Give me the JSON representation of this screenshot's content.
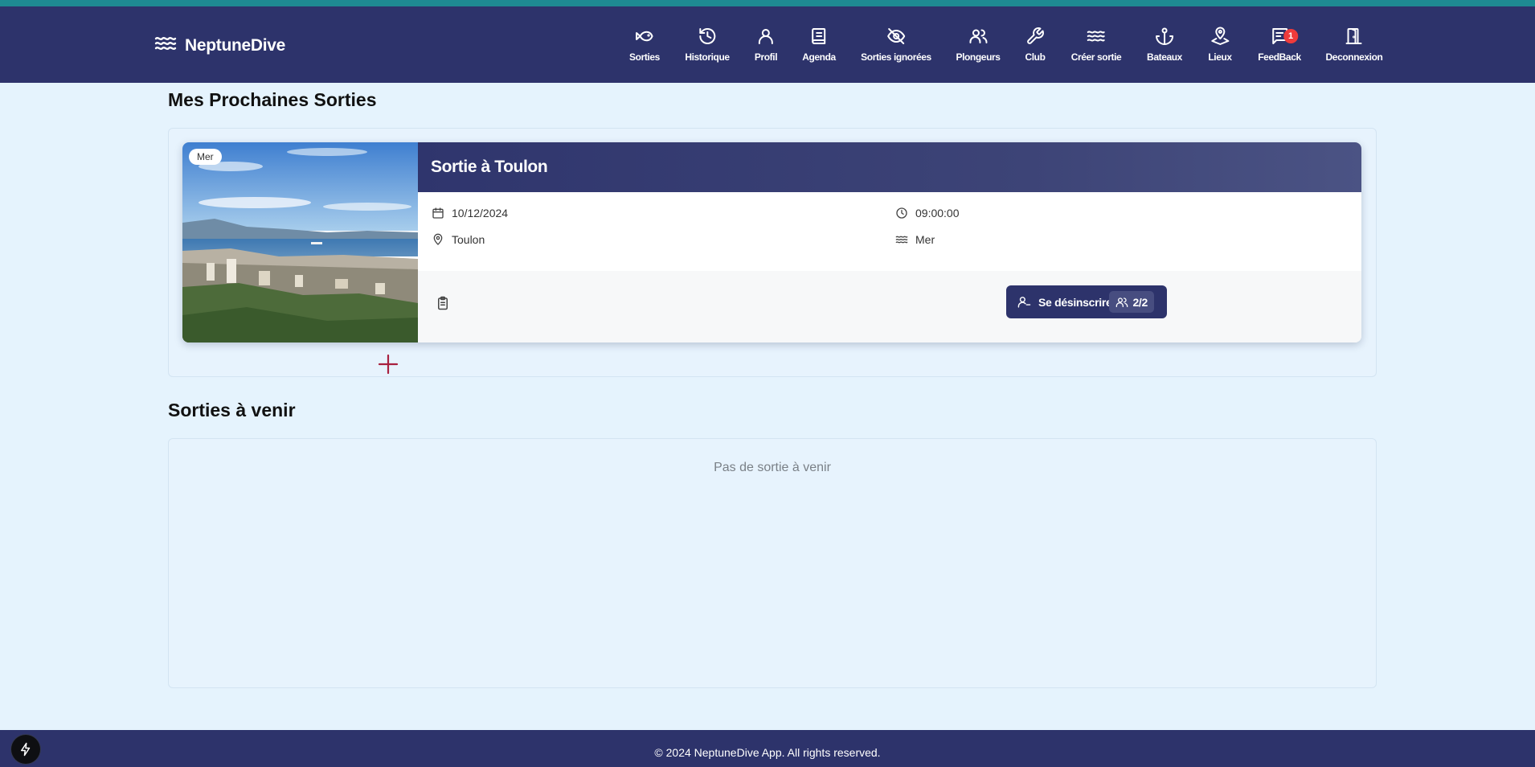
{
  "app": {
    "brand_name": "NeptuneDive",
    "brand_icon": "waves-icon",
    "primary_color": "#2d336b",
    "background_color": "#e5f3fd"
  },
  "nav": {
    "items": [
      {
        "label": "Sorties",
        "icon": "fish-icon"
      },
      {
        "label": "Historique",
        "icon": "history-icon"
      },
      {
        "label": "Profil",
        "icon": "user-icon"
      },
      {
        "label": "Agenda",
        "icon": "book-icon"
      },
      {
        "label": "Sorties ignorées",
        "icon": "eye-off-icon"
      },
      {
        "label": "Plongeurs",
        "icon": "users-icon"
      },
      {
        "label": "Club",
        "icon": "wrench-icon"
      },
      {
        "label": "Créer sortie",
        "icon": "waves-icon"
      },
      {
        "label": "Bateaux",
        "icon": "anchor-icon"
      },
      {
        "label": "Lieux",
        "icon": "map-pin-icon"
      },
      {
        "label": "FeedBack",
        "icon": "message-icon",
        "badge": "1"
      },
      {
        "label": "Deconnexion",
        "icon": "door-icon"
      }
    ]
  },
  "my_outings": {
    "title": "Mes Prochaines Sorties",
    "cards": [
      {
        "type_tag": "Mer",
        "title": "Sortie à Toulon",
        "date": "10/12/2024",
        "time": "09:00:00",
        "location": "Toulon",
        "environment": "Mer",
        "unsubscribe_label": "Se désinscrire",
        "participants": "2/2"
      }
    ]
  },
  "upcoming": {
    "title": "Sorties à venir",
    "empty_message": "Pas de sortie à venir"
  },
  "footer": {
    "text": "© 2024 NeptuneDive App. All rights reserved."
  }
}
